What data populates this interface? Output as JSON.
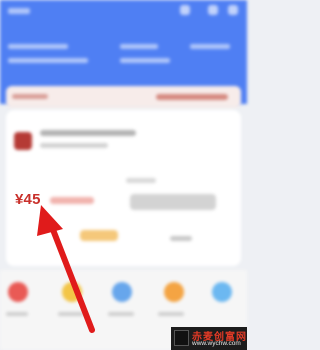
{
  "product": {
    "price": "¥45"
  },
  "watermark": {
    "title": "赤麦创富网",
    "url": "www.wychw.com"
  },
  "colors": {
    "header_blue": "#4f7ff3",
    "price_red": "#c8302b",
    "arrow_red": "#e01b1b"
  }
}
